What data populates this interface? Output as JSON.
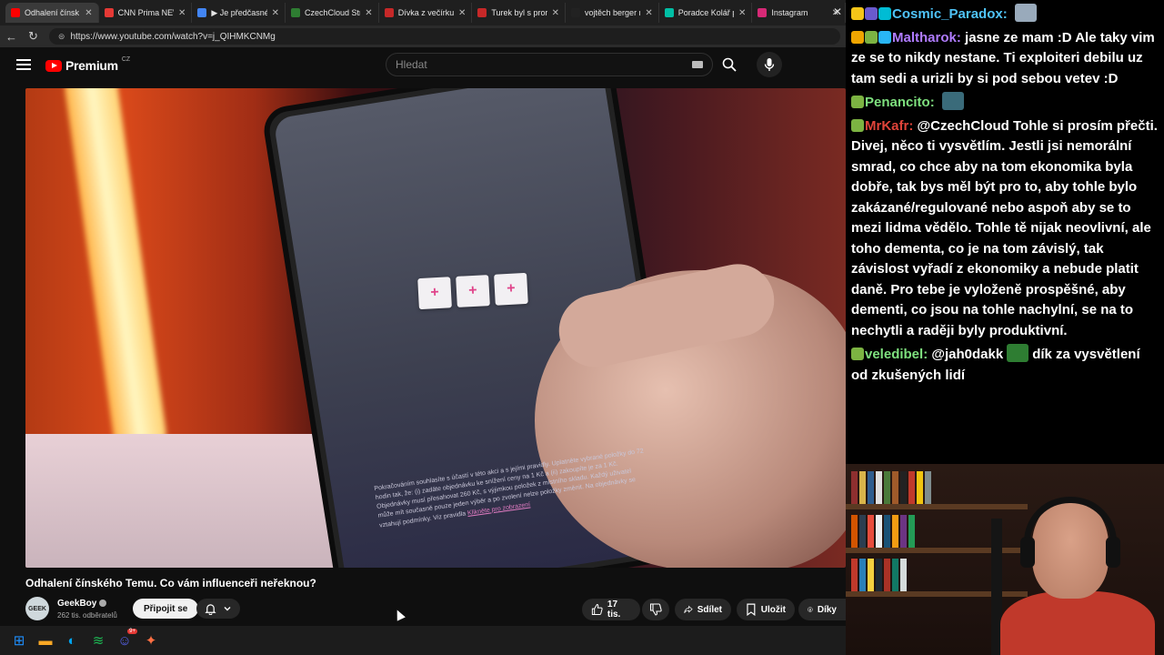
{
  "browser": {
    "tabs": [
      {
        "label": "Odhalení čínsk",
        "color": "#ff0000",
        "active": true
      },
      {
        "label": "CNN Prima NEWS",
        "color": "#e53935"
      },
      {
        "label": "▶ Je předčasné ře",
        "color": "#4285f4"
      },
      {
        "label": "CzechCloud Strea",
        "color": "#2e7d32"
      },
      {
        "label": "Dívka z večírku Fil",
        "color": "#c62828"
      },
      {
        "label": "Turek byl s prorus",
        "color": "#c62828"
      },
      {
        "label": "vojtěch berger na",
        "color": "#222222"
      },
      {
        "label": "Poradce Kolář přis",
        "color": "#00bfa5"
      },
      {
        "label": "Instagram",
        "color": "#d62976"
      }
    ],
    "url": "https://www.youtube.com/watch?v=j_QIHMKCNMg"
  },
  "youtube": {
    "logo_text": "Premium",
    "logo_region": "CZ",
    "search_placeholder": "Hledat",
    "video_title": "Odhalení čínského Temu. Co vám influenceři neřeknou?",
    "channel_name": "GeekBoy",
    "channel_subs": "262 tis. odběratelů",
    "avatar_text": "GEEK",
    "join_label": "Připojit se",
    "like_count": "17 tis.",
    "share_label": "Sdílet",
    "save_label": "Uložit",
    "thanks_label": "Díky",
    "video_overlay": {
      "plus_buttons": [
        "+",
        "+",
        "+"
      ],
      "terms_text": "Pokračováním souhlasíte s účastí v této akci a s jejími pravidly. Uplatněte vybrané položky do 72 hodin tak, že: (i) zadáte objednávku ke snížení ceny na 1 Kč a (ii) zakoupíte je za 1 Kč. Objednávky musí přesahovat 260 Kč, s výjimkou položek z místního skladu. Každý uživatel může mít současně pouze jeden výběr a po zvolení nelze položky změnit. Na objednávky se vztahují podmínky. Viz pravidla",
      "terms_link": "Klikněte pro zobrazení"
    }
  },
  "chat": {
    "messages": [
      {
        "user": "Cosmic_Paradox",
        "color": "#4fc3f7",
        "badges": [
          "#f5c518",
          "#6a5acd",
          "#00bcd4"
        ],
        "text": "",
        "emote": "#9ab"
      },
      {
        "user": "Maltharok",
        "color": "#b07cff",
        "badges": [
          "#f0a500",
          "#7cb342",
          "#29b6f6"
        ],
        "text": "jasne ze mam :D Ale taky vim ze se to nikdy nestane. Ti exploiteri debilu uz tam sedi a urizli by si pod sebou vetev :D"
      },
      {
        "user": "Penancito",
        "color": "#7ee07e",
        "badges": [
          "#7cb342"
        ],
        "text": "",
        "emote": "#3a6b7a"
      },
      {
        "user": "MrKafr",
        "color": "#e0443a",
        "badges": [
          "#7cb342"
        ],
        "text": "@CzechCloud Tohle si prosím přečti. Divej, něco ti vysvětlím. Jestli jsi nemorální smrad, co chce aby na tom ekonomika byla dobře, tak bys měl být pro to, aby tohle bylo zakázané/regulované nebo aspoň aby se to mezi lidma vědělo. Tohle tě nijak neovlivní, ale toho dementa, co je na tom závislý, tak závislost vyřadí z ekonomiky a nebude platit daně. Pro tebe je vyloženě prospěšné, aby dementi, co jsou na tohle nachylní, se na to nechytli a raději byly produktivní."
      },
      {
        "user": "veledibel",
        "color": "#7ee07e",
        "badges": [
          "#7cb342"
        ],
        "text": "@jah0dakk",
        "emote": "#2e7d32",
        "text2": "dík za vysvětlení od zkušených lidí"
      }
    ]
  },
  "taskbar": {
    "icons": [
      {
        "name": "windows-start-icon",
        "color": "#1e90ff",
        "glyph": "⊞"
      },
      {
        "name": "file-explorer-icon",
        "color": "#f9a825",
        "glyph": "▬"
      },
      {
        "name": "edge-browser-icon",
        "color": "#00a4ef",
        "glyph": "◐"
      },
      {
        "name": "spotify-icon",
        "color": "#1db954",
        "glyph": "≋"
      },
      {
        "name": "discord-icon",
        "color": "#5865f2",
        "glyph": "☺",
        "badge": "9+"
      },
      {
        "name": "app-icon",
        "color": "#ff7043",
        "glyph": "✦"
      }
    ]
  },
  "colors": {
    "accent": "#ff0000",
    "pink": "#e0438a"
  }
}
